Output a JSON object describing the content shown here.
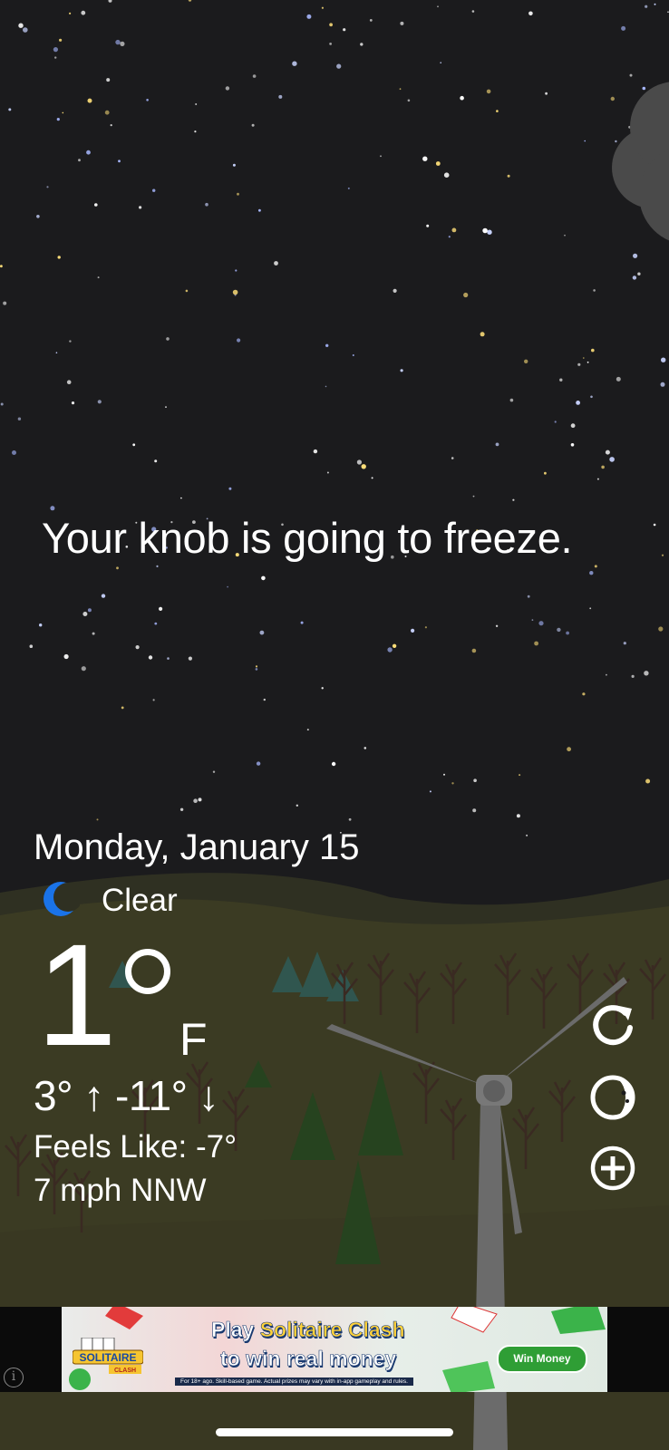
{
  "tagline": "Your knob is going to freeze.",
  "weather": {
    "date": "Monday, January 15",
    "condition": "Clear",
    "temperature": "1",
    "unit": "F",
    "high_low": "3° ↑  -11° ↓",
    "feels_like": "Feels Like: -7°",
    "wind": "7 mph NNW"
  },
  "actions": {
    "refresh": "refresh-icon",
    "moon_phase": "moon-phase-icon",
    "add": "add-location-icon"
  },
  "ad": {
    "brand_line1": "SOLITAIRE",
    "brand_line2": "CLASH",
    "headline_part1": "Play ",
    "headline_highlight": "Solitaire Clash",
    "headline_line2": "to win real money",
    "cta": "Win Money",
    "fine_print": "For 18+ ago. Skill-based game. Actual prizes may vary with in-app gameplay and rules.",
    "info_icon": "i"
  },
  "colors": {
    "sky": "#1b1b1d",
    "hills": "#3a3a23",
    "moon": "#1a73e8",
    "text": "#ffffff"
  }
}
